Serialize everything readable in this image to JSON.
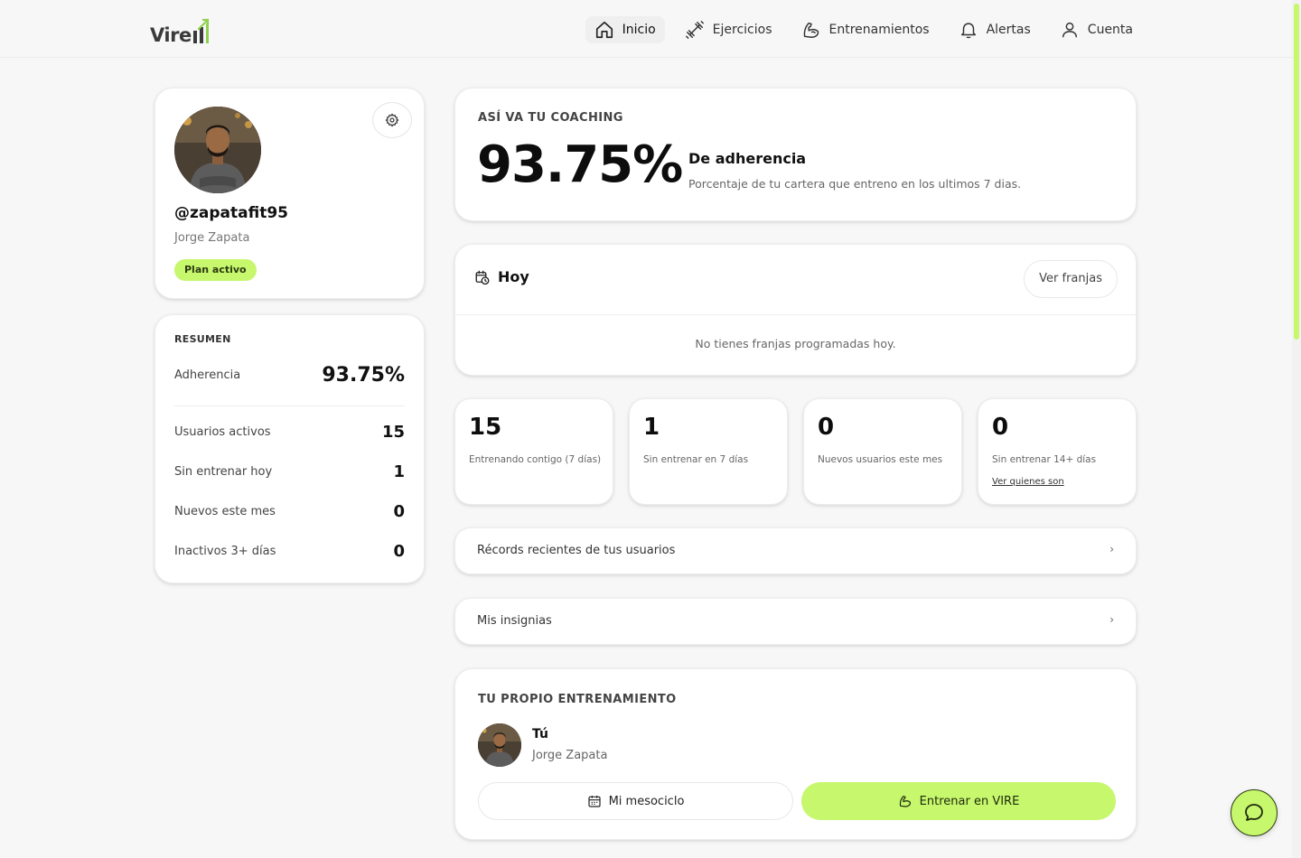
{
  "brand": {
    "logo_text": "Vire",
    "accent": "#c6f76d"
  },
  "nav": [
    {
      "label": "Inicio",
      "icon": "home-icon",
      "active": true
    },
    {
      "label": "Ejercicios",
      "icon": "dumbbell-icon"
    },
    {
      "label": "Entrenamientos",
      "icon": "biceps-icon"
    },
    {
      "label": "Alertas",
      "icon": "bell-icon"
    },
    {
      "label": "Cuenta",
      "icon": "user-icon"
    }
  ],
  "profile": {
    "handle": "@zapatafit95",
    "name": "Jorge Zapata",
    "badge": "Plan activo"
  },
  "resumen": {
    "title": "RESUMEN",
    "adherencia_label": "Adherencia",
    "adherencia_value": "93.75%",
    "rows": [
      {
        "label": "Usuarios activos",
        "value": "15"
      },
      {
        "label": "Sin entrenar hoy",
        "value": "1"
      },
      {
        "label": "Nuevos este mes",
        "value": "0"
      },
      {
        "label": "Inactivos 3+ días",
        "value": "0"
      }
    ]
  },
  "coaching": {
    "title": "ASÍ VA TU COACHING",
    "value": "93.75%",
    "sub_title": "De adherencia",
    "sub_text": "Porcentaje de tu cartera que entreno en los ultimos 7 dias."
  },
  "hoy": {
    "title": "Hoy",
    "button": "Ver franjas",
    "empty": "No tienes franjas programadas hoy."
  },
  "stats": [
    {
      "value": "15",
      "label": "Entrenando contigo (7 días)"
    },
    {
      "value": "1",
      "label": "Sin entrenar en 7 días"
    },
    {
      "value": "0",
      "label": "Nuevos usuarios este mes"
    },
    {
      "value": "0",
      "label": "Sin entrenar 14+ días",
      "link": "Ver quienes son"
    }
  ],
  "links": [
    {
      "label": "Récords recientes de tus usuarios",
      "chevron": "›"
    },
    {
      "label": "Mis insignias",
      "chevron": "›"
    }
  ],
  "own": {
    "title": "TU PROPIO ENTRENAMIENTO",
    "name": "Tú",
    "full_name": "Jorge Zapata",
    "btn_mesociclo": "Mi mesociclo",
    "btn_entrenar": "Entrenar en VIRE"
  }
}
